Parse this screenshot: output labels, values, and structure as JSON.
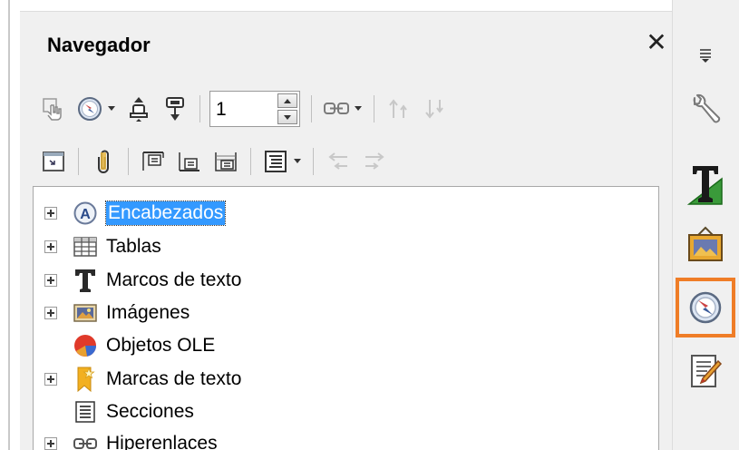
{
  "panel": {
    "title": "Navegador",
    "close_glyph": "✕"
  },
  "toolbar1": {
    "buttons": [
      "drag-mode-icon",
      "navigation-compass-icon",
      "previous-object-icon",
      "next-object-icon"
    ],
    "page_value": "1",
    "more": [
      "hyperlink-insert-icon",
      "promote-icon",
      "demote-icon"
    ]
  },
  "toolbar2": {
    "buttons": [
      "toggle-master-view-icon",
      "reminder-icon",
      "header-icon",
      "footer-icon",
      "anchor-icon",
      "heading-levels-icon",
      "promote-level-icon",
      "demote-level-icon"
    ]
  },
  "tree": {
    "items": [
      {
        "label": "Encabezados",
        "icon": "headings-icon",
        "expandable": true,
        "selected": true
      },
      {
        "label": "Tablas",
        "icon": "table-icon",
        "expandable": true,
        "selected": false
      },
      {
        "label": "Marcos de texto",
        "icon": "text-frame-icon",
        "expandable": true,
        "selected": false
      },
      {
        "label": "Imágenes",
        "icon": "image-icon",
        "expandable": true,
        "selected": false
      },
      {
        "label": "Objetos OLE",
        "icon": "ole-object-icon",
        "expandable": false,
        "selected": false
      },
      {
        "label": "Marcas de texto",
        "icon": "bookmark-icon",
        "expandable": true,
        "selected": false
      },
      {
        "label": "Secciones",
        "icon": "section-icon",
        "expandable": false,
        "selected": false
      },
      {
        "label": "Hiperenlaces",
        "icon": "hyperlink-icon",
        "expandable": true,
        "selected": false
      }
    ]
  },
  "sidebar": {
    "buttons": [
      "menu-icon",
      "properties-icon",
      "styles-icon",
      "gallery-icon",
      "navigator-icon",
      "manage-changes-icon"
    ],
    "active": "navigator-icon",
    "active_color": "#ef7d27"
  },
  "colors": {
    "selection": "#3399ff",
    "panel_bg": "#f0f0f0"
  }
}
